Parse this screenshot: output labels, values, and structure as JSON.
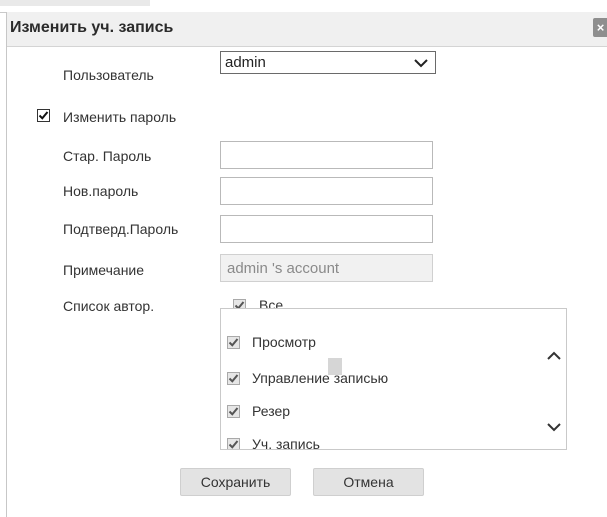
{
  "dialog": {
    "title": "Изменить уч. запись",
    "close_symbol": "×"
  },
  "form": {
    "user_label": "Пользователь",
    "user_value": "admin",
    "change_password_label": "Изменить пароль",
    "change_password_checked": true,
    "old_password_label": "Стар. Пароль",
    "old_password_value": "",
    "new_password_label": "Нов.пароль",
    "new_password_value": "",
    "confirm_password_label": "Подтверд.Пароль",
    "confirm_password_value": "",
    "note_label": "Примечание",
    "note_value": "admin 's account",
    "permissions_label": "Список автор.",
    "all_label": "Все"
  },
  "permissions": [
    {
      "label": "Просмотр",
      "checked": true
    },
    {
      "label": "Управление записью",
      "checked": true
    },
    {
      "label": "Резер",
      "checked": true
    },
    {
      "label": "Уч. запись",
      "checked": true
    }
  ],
  "buttons": {
    "save": "Сохранить",
    "cancel": "Отмена"
  }
}
